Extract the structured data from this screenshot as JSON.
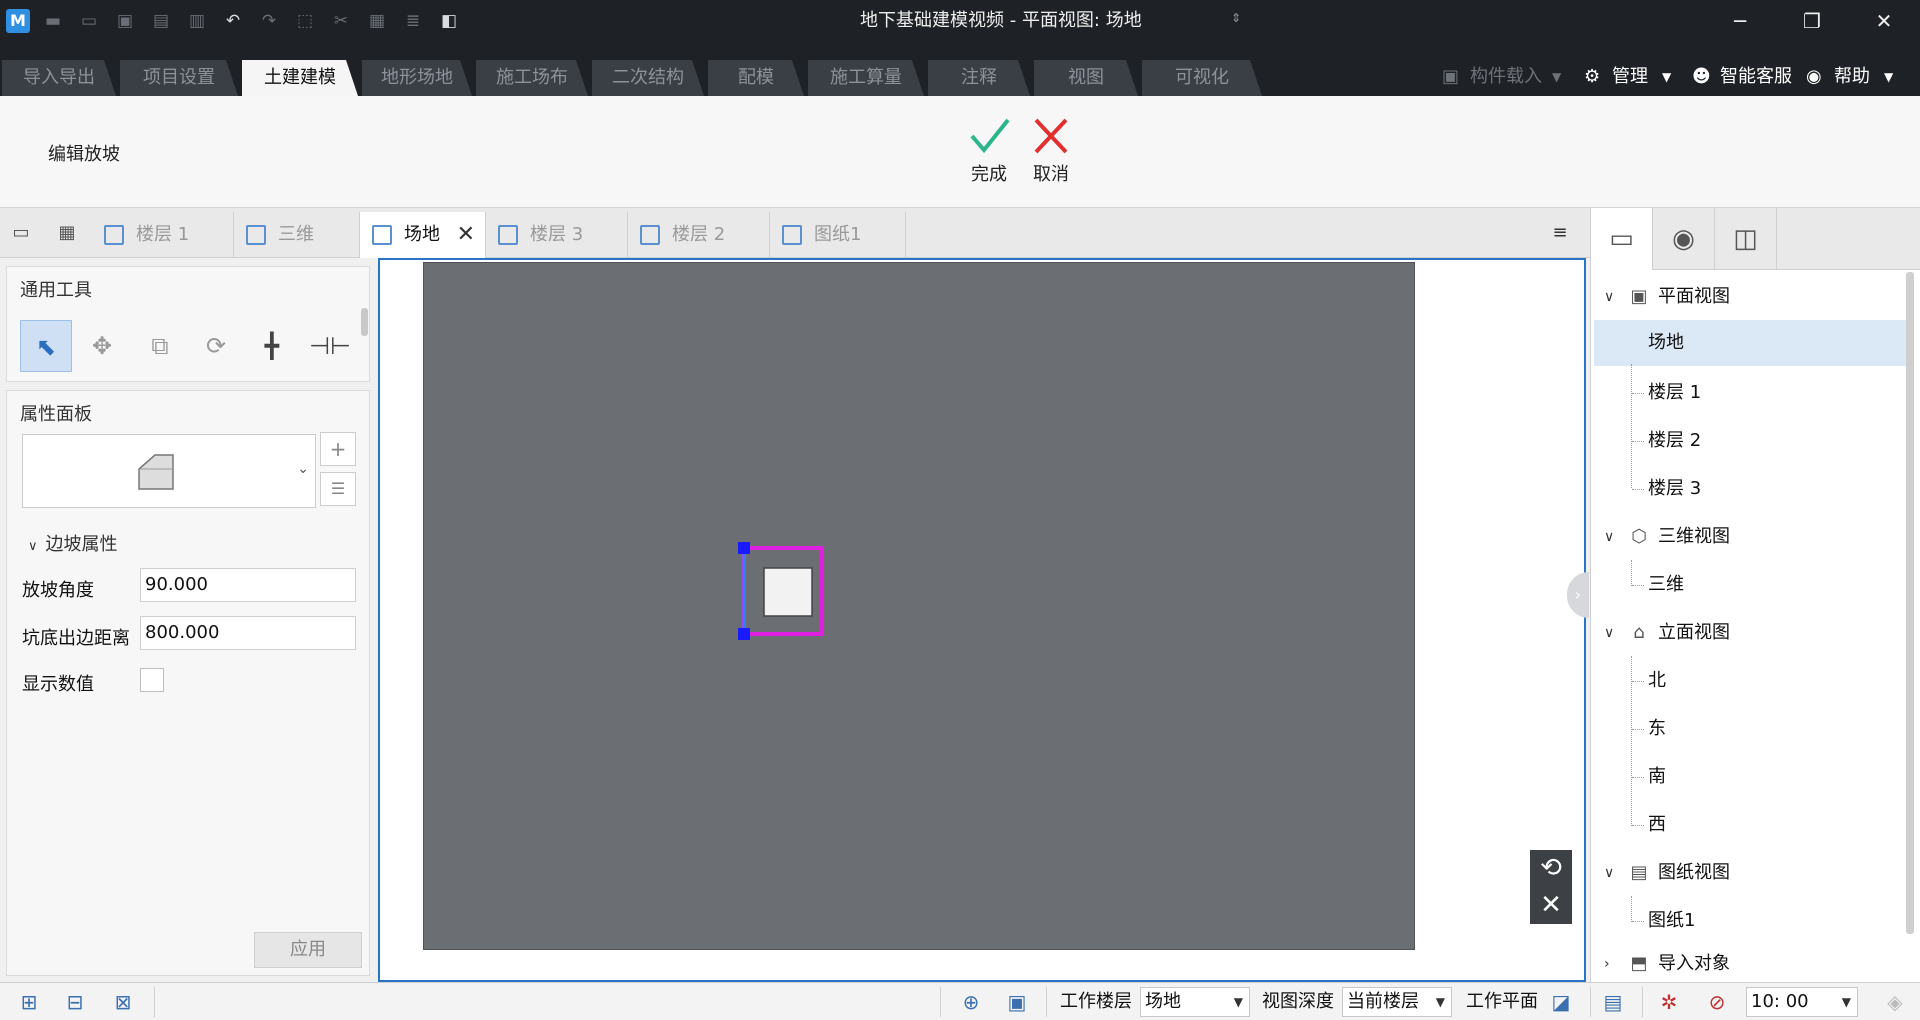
{
  "window": {
    "title": "地下基础建模视频 - 平面视图: 场地",
    "logo": "M",
    "minimize_icon": "─",
    "restore_icon": "❐",
    "close_icon": "✕"
  },
  "quick_access": [
    "save-icon",
    "open-icon",
    "save-as-icon",
    "print-icon",
    "copy-file-icon",
    "undo-icon",
    "redo-icon",
    "select-icon",
    "cut-icon",
    "paste-icon",
    "stack-icon",
    "cube-icon"
  ],
  "ribbon_tabs": [
    {
      "label": "导入导出"
    },
    {
      "label": "项目设置"
    },
    {
      "label": "土建建模",
      "active": true
    },
    {
      "label": "地形场地"
    },
    {
      "label": "施工场布"
    },
    {
      "label": "二次结构"
    },
    {
      "label": "配模"
    },
    {
      "label": "施工算量"
    },
    {
      "label": "注释"
    },
    {
      "label": "视图"
    },
    {
      "label": "可视化"
    }
  ],
  "ribbon_right": {
    "component_load": "构件载入",
    "manage": "管理",
    "smart_service": "智能客服",
    "help": "帮助"
  },
  "ribbon": {
    "mode_label": "编辑放坡",
    "finish_label": "完成",
    "cancel_label": "取消",
    "finish_color": "#2bb58a",
    "cancel_color": "#e03030"
  },
  "doc_tabs": [
    {
      "label": "楼层 1"
    },
    {
      "label": "三维"
    },
    {
      "label": "场地",
      "active": true
    },
    {
      "label": "楼层 3"
    },
    {
      "label": "楼层 2"
    },
    {
      "label": "图纸1"
    }
  ],
  "left_panel": {
    "tools_title": "通用工具",
    "tools": [
      "pointer-icon",
      "move-icon",
      "copy-icon",
      "rotate-icon",
      "trim-icon",
      "split-icon"
    ],
    "props_title": "属性面板",
    "section": "边坡属性",
    "props": [
      {
        "label": "放坡角度",
        "value": "90.000"
      },
      {
        "label": "坑底出边距离",
        "value": "800.000"
      }
    ],
    "show_values_label": "显示数值",
    "show_values_checked": false,
    "apply_label": "应用"
  },
  "canvas": {
    "plane_color": "#6b6f74",
    "selection_color": "#e020e0",
    "grip_color": "#1a1aff"
  },
  "tree": {
    "plan_views": "平面视图",
    "plan_items": [
      "场地",
      "楼层 1",
      "楼层 2",
      "楼层 3"
    ],
    "threed_views": "三维视图",
    "threed_items": [
      "三维"
    ],
    "elevation_views": "立面视图",
    "elevation_items": [
      "北",
      "东",
      "南",
      "西"
    ],
    "sheet_views": "图纸视图",
    "sheet_items": [
      "图纸1"
    ],
    "import_objects": "导入对象"
  },
  "status_bar": {
    "work_floor_label": "工作楼层",
    "work_floor_value": "场地",
    "view_depth_label": "视图深度",
    "view_depth_value": "当前楼层",
    "work_plane_label": "工作平面",
    "time_value": "10: 00"
  },
  "colors": {
    "accent": "#2a74c8",
    "titlebar": "#1e2126"
  }
}
